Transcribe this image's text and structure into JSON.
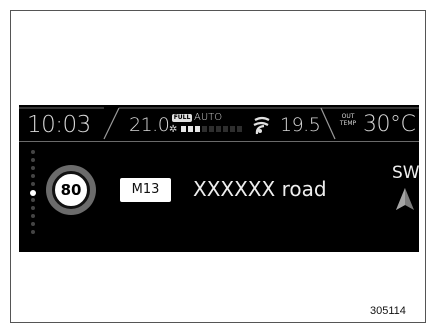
{
  "status_bar": {
    "clock": "10:03",
    "left_temp": "21.0",
    "fan_mode_badge": "FULL",
    "fan_auto": "AUTO",
    "fan_level": {
      "filled": 3,
      "total": 9
    },
    "right_temp": "19.5",
    "outside_label_line1": "OUT",
    "outside_label_line2": "TEMP",
    "outside_temp": "30°C"
  },
  "navigation": {
    "speed_limit": "80",
    "road_number": "M13",
    "road_name": "XXXXXX road",
    "heading": "SW"
  },
  "figure_id": "305114",
  "colors": {
    "display_background": "#000000",
    "text": "#d8d8d8",
    "divider": "#6a6a6a"
  },
  "icons": [
    "fan-icon",
    "airflow-icon",
    "compass-arrow-icon"
  ]
}
